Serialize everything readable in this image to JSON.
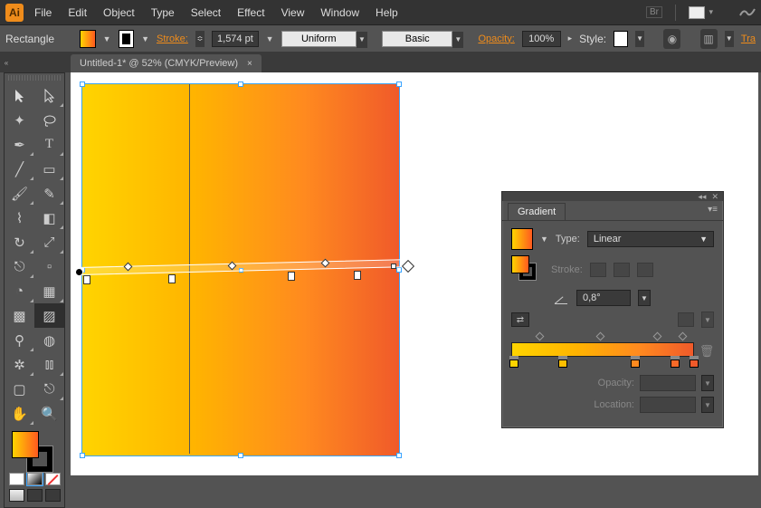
{
  "menu": {
    "items": [
      "File",
      "Edit",
      "Object",
      "Type",
      "Select",
      "Effect",
      "View",
      "Window",
      "Help"
    ],
    "br_label": "Br"
  },
  "controlbar": {
    "shape_label": "Rectangle",
    "stroke_label": "Stroke:",
    "stroke_weight": "1,574 pt",
    "profile": "Uniform",
    "brush": "Basic",
    "opacity_label": "Opacity:",
    "opacity_value": "100%",
    "style_label": "Style:",
    "transform_link": "Tra"
  },
  "tab": {
    "title": "Untitled-1* @ 52% (CMYK/Preview)"
  },
  "gradient_panel": {
    "title": "Gradient",
    "type_label": "Type:",
    "type_value": "Linear",
    "stroke_label": "Stroke:",
    "angle_value": "0,8°",
    "opacity_label": "Opacity:",
    "location_label": "Location:"
  },
  "chart_data": {
    "type": "gradient",
    "mode": "Linear",
    "angle_deg": 0.8,
    "stops": [
      {
        "position_pct": 0,
        "color": "#ffd400"
      },
      {
        "position_pct": 27,
        "color": "#ffbf00"
      },
      {
        "position_pct": 63,
        "color": "#ff8a1f"
      },
      {
        "position_pct": 84,
        "color": "#f96a28"
      },
      {
        "position_pct": 100,
        "color": "#f05a2a"
      }
    ],
    "midpoints_pct": [
      14,
      47,
      78,
      92
    ]
  }
}
